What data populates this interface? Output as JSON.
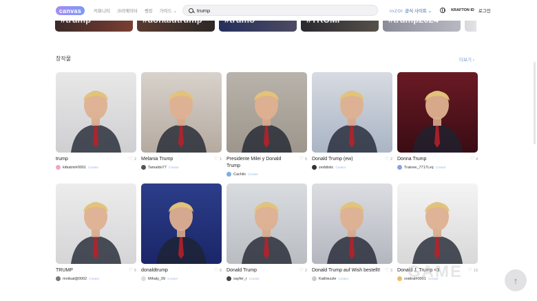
{
  "header": {
    "logo": "canvas",
    "nav": [
      "커뮤니티",
      "크리에이터",
      "랭킹",
      "가이드 ⌄"
    ],
    "search_value": "trump",
    "official_brand": "inZOI",
    "official_label": "공식 사이트 ⌄",
    "krafton": "KRAFTON ID",
    "login": "로그인"
  },
  "hashtags": [
    "#trump",
    "#donaldtrump",
    "#trumo",
    "#TRUMP",
    "#trump2024",
    ""
  ],
  "section": {
    "title": "창작물",
    "more": "더보기 ›"
  },
  "badge_label": "Creator",
  "cards": [
    {
      "title": "trump",
      "likes": "2",
      "author": "kitkatmi#0001",
      "bg": [
        "#e8e8e8",
        "#cfcfd2"
      ],
      "avatar": "#f4a3c8"
    },
    {
      "title": "Melania Trump",
      "likes": "1",
      "author": "Tamaldo77",
      "bg": [
        "#d8d2cc",
        "#b5aaa0"
      ],
      "avatar": "#555"
    },
    {
      "title": "Presidente Milei y Donald Trump",
      "likes": "5",
      "author": "Cachilx",
      "bg": [
        "#b8b3ab",
        "#9e968c"
      ],
      "avatar": "#78b0e0"
    },
    {
      "title": "Donald Trump (ew)",
      "likes": "2",
      "author": "zeddistic",
      "bg": [
        "#d7dbe2",
        "#aab4c4"
      ],
      "avatar": "#333"
    },
    {
      "title": "Donna Trump",
      "likes": "4",
      "author": "Trainee_7717Lvq",
      "bg": [
        "#6a1a24",
        "#3a0c14"
      ],
      "avatar": "#8aa0e6"
    },
    {
      "title": "TRUMP",
      "likes": "5",
      "author": "mnilsat@0002",
      "bg": [
        "#ececec",
        "#d5d5d7"
      ],
      "avatar": "#777"
    },
    {
      "title": "donaldtrump",
      "likes": "6",
      "author": "Mihaly_09",
      "bg": [
        "#2c3e8a",
        "#1a2668"
      ],
      "avatar": "#ddd"
    },
    {
      "title": "Donald Trump",
      "likes": "2",
      "author": "sayfer_r",
      "bg": [
        "#d9dcdf",
        "#b9bdc2"
      ],
      "avatar": "#444"
    },
    {
      "title": "Donald Trump auf Wish bestellt!",
      "likes": "3",
      "author": "Kathiezzle",
      "bg": [
        "#dcdde2",
        "#b4b6bf"
      ],
      "avatar": "#ccc"
    },
    {
      "title": "Donald J. Trump <3",
      "likes": "13",
      "author": "voidrat#0001",
      "bg": [
        "#f4f4f4",
        "#d8d8d8"
      ],
      "avatar": "#e8c060"
    }
  ],
  "watermark": "GAME",
  "to_top": "↑"
}
